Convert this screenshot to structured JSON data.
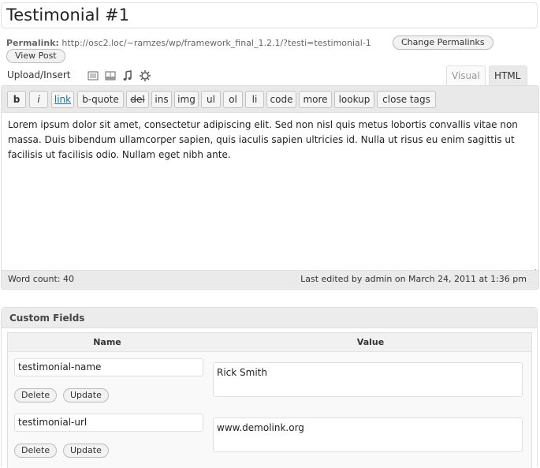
{
  "post": {
    "title": "Testimonial #1",
    "permalink_label": "Permalink:",
    "permalink_url": "http://osc2.loc/~ramzes/wp/framework_final_1.2.1/?testi=testimonial-1",
    "change_permalinks_label": "Change Permalinks",
    "view_post_label": "View Post"
  },
  "upload": {
    "label": "Upload/Insert",
    "icons": [
      "image-icon",
      "video-icon",
      "audio-icon",
      "media-icon"
    ]
  },
  "editor": {
    "tabs": {
      "visual": "Visual",
      "html": "HTML"
    },
    "quicktags": [
      "b",
      "i",
      "link",
      "b-quote",
      "del",
      "ins",
      "img",
      "ul",
      "ol",
      "li",
      "code",
      "more",
      "lookup",
      "close tags"
    ],
    "content": "Lorem ipsum dolor sit amet, consectetur adipiscing elit. Sed non nisl quis metus lobortis convallis vitae non massa. Duis bibendum ullamcorper sapien, quis iaculis sapien ultricies id. Nulla ut risus eu enim sagittis ut facilisis ut facilisis odio. Nullam eget nibh ante.",
    "word_count": "Word count: 40",
    "last_edited": "Last edited by admin on March 24, 2011 at 1:36 pm"
  },
  "custom_fields": {
    "title": "Custom Fields",
    "col_name": "Name",
    "col_value": "Value",
    "delete_label": "Delete",
    "update_label": "Update",
    "rows": [
      {
        "name": "testimonial-name",
        "value": "Rick Smith"
      },
      {
        "name": "testimonial-url",
        "value": "www.demolink.org"
      }
    ]
  }
}
